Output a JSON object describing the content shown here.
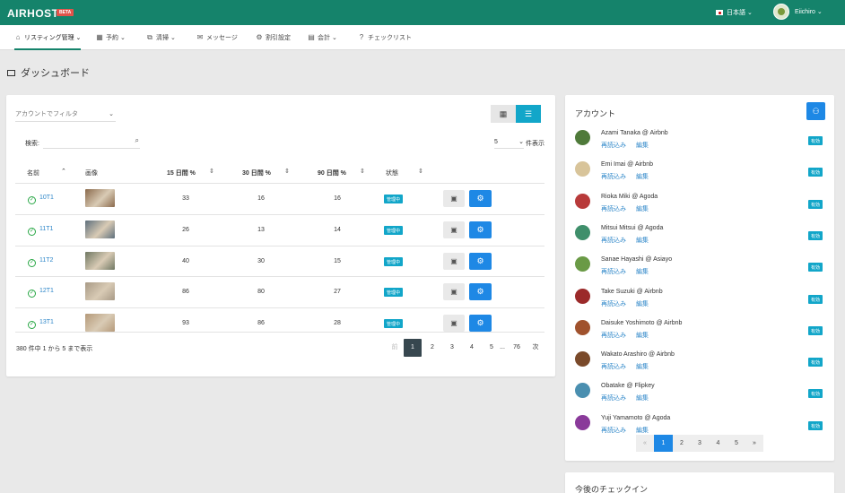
{
  "app": {
    "brand": "AIRHOST",
    "beta": "BETA"
  },
  "topbar": {
    "language": "日本語 ⌄",
    "user": "Eiichiro ⌄"
  },
  "nav": [
    {
      "icon": "⌂",
      "label": "リスティング管理 ⌄"
    },
    {
      "icon": "▦",
      "label": "予約 ⌄"
    },
    {
      "icon": "⧉",
      "label": "清掃 ⌄"
    },
    {
      "icon": "✉",
      "label": "メッセージ"
    },
    {
      "icon": "⚙",
      "label": "割引設定"
    },
    {
      "icon": "▤",
      "label": "会計 ⌄"
    },
    {
      "icon": "?",
      "label": "チェックリスト"
    }
  ],
  "page": {
    "title": "ダッシュボード"
  },
  "listings": {
    "filter_placeholder": "アカウントでフィルタ",
    "search_label": "検索:",
    "page_size": "5",
    "page_size_suffix": "件表示",
    "columns": [
      "名前",
      "画像",
      "15 日間 %",
      "30 日間 %",
      "90 日間 %",
      "状態"
    ],
    "rows": [
      {
        "name": "10T1",
        "d15": "33",
        "d30": "16",
        "d90": "16",
        "status": "管理中",
        "thumb": "#8a6a4c"
      },
      {
        "name": "11T1",
        "d15": "26",
        "d30": "13",
        "d90": "14",
        "status": "管理中",
        "thumb": "#5e6f7c"
      },
      {
        "name": "11T2",
        "d15": "40",
        "d30": "30",
        "d90": "15",
        "status": "管理中",
        "thumb": "#6f7762"
      },
      {
        "name": "12T1",
        "d15": "86",
        "d30": "80",
        "d90": "27",
        "status": "管理中",
        "thumb": "#a89a86"
      },
      {
        "name": "13T1",
        "d15": "93",
        "d30": "86",
        "d90": "28",
        "status": "管理中",
        "thumb": "#b59a7a"
      }
    ],
    "summary": "380 件中 1 から 5 まで表示",
    "pagination": [
      "前",
      "1",
      "2",
      "3",
      "4",
      "5",
      "...",
      "76",
      "次"
    ]
  },
  "accounts": {
    "title": "アカウント",
    "reload_label": "再読込み",
    "edit_label": "編集",
    "badge": "有効",
    "items": [
      {
        "name": "Azami Tanaka @ Airbnb",
        "color": "#4f7a3a"
      },
      {
        "name": "Emi Imai @ Airbnb",
        "color": "#d8c49a"
      },
      {
        "name": "Rioka Miki @ Agoda",
        "color": "#b83a3a"
      },
      {
        "name": "Mitsui Mitsui @ Agoda",
        "color": "#3f8f6b"
      },
      {
        "name": "Sanae Hayashi @ Asiayo",
        "color": "#6a9a46"
      },
      {
        "name": "Take Suzuki @ Airbnb",
        "color": "#9b2a2a"
      },
      {
        "name": "Daisuke Yoshimoto @ Airbnb",
        "color": "#a0522d"
      },
      {
        "name": "Wakato Arashiro @ Airbnb",
        "color": "#7a4a2a"
      },
      {
        "name": "Obatake @ Flipkey",
        "color": "#4a8fb0"
      },
      {
        "name": "Yuji Yamamoto @ Agoda",
        "color": "#8a3a9a"
      }
    ],
    "pagination": [
      "«",
      "1",
      "2",
      "3",
      "4",
      "5",
      "»"
    ]
  },
  "checkins": {
    "title": "今後のチェックイン"
  }
}
